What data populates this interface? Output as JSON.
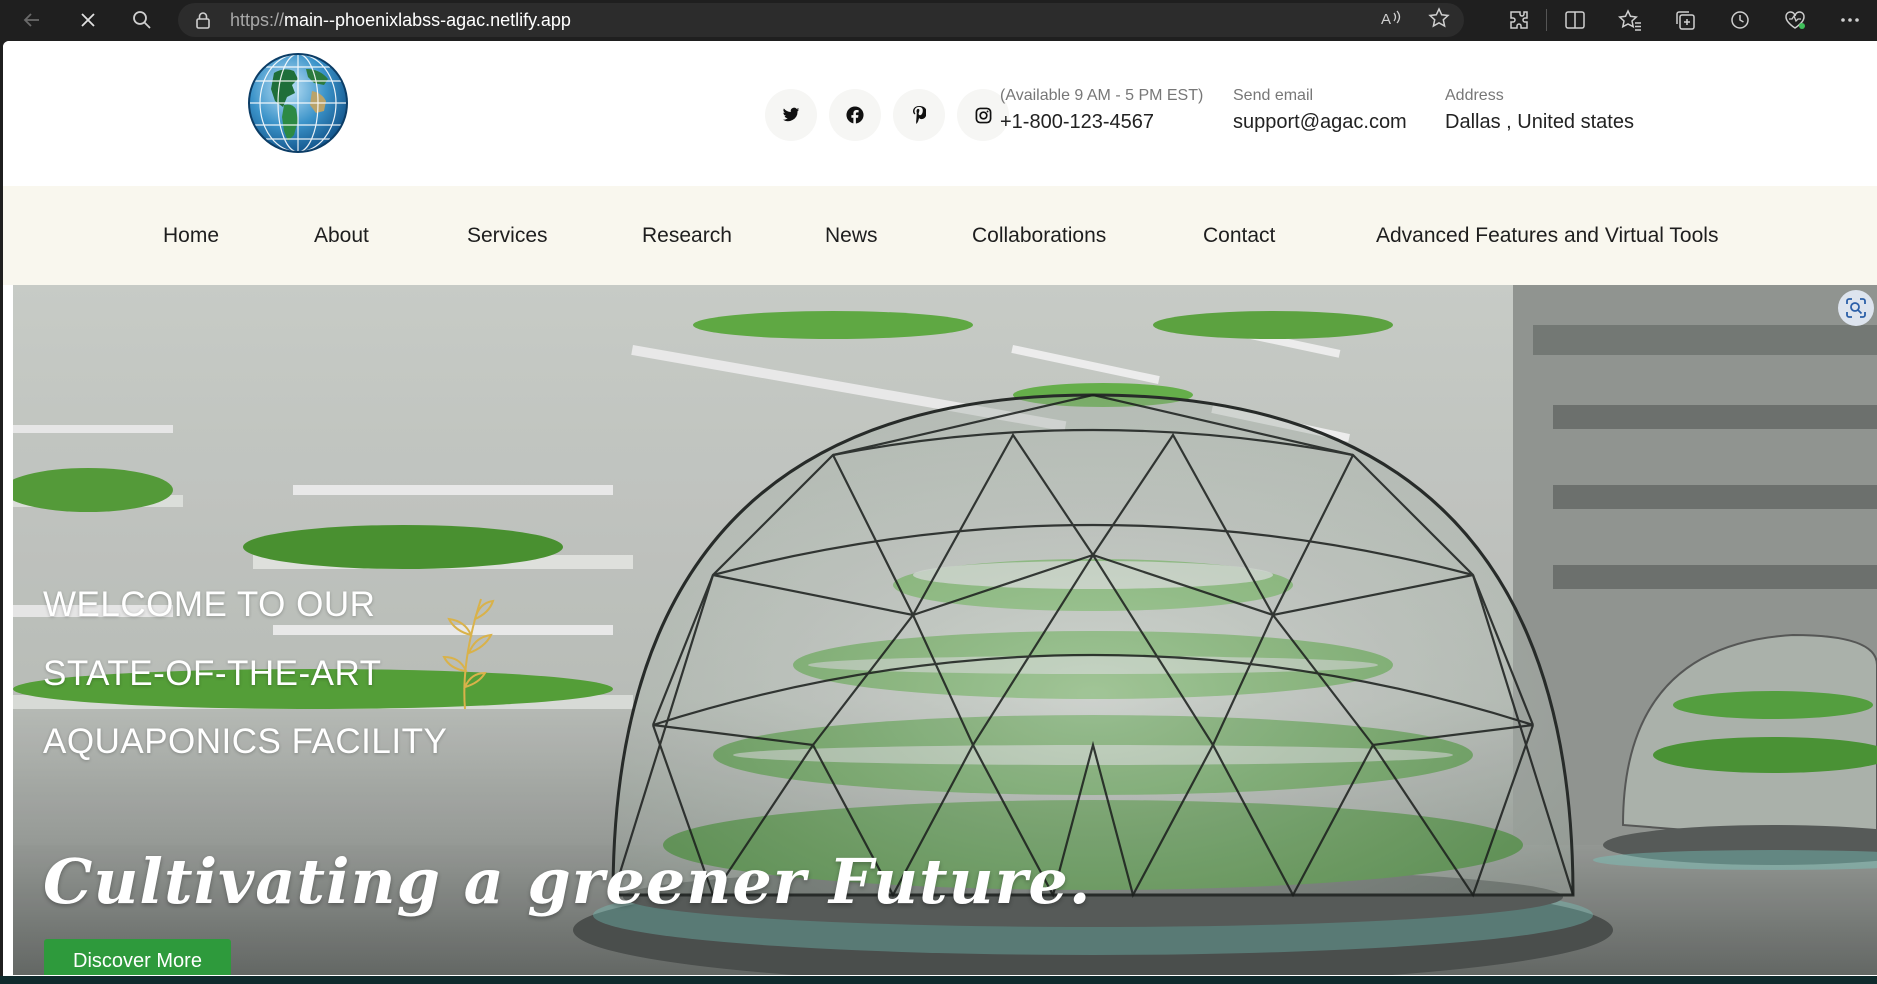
{
  "browser": {
    "url_scheme": "https://",
    "url_host": "main--phoenixlabss-agac.netlify.app",
    "icons": [
      "back-arrow-icon",
      "stop-icon",
      "search-icon",
      "lock-icon",
      "read-aloud-icon",
      "favorite-star-icon",
      "extensions-icon",
      "split-screen-icon",
      "favorites-icon",
      "collections-icon",
      "history-icon",
      "browser-essentials-icon",
      "more-icon"
    ]
  },
  "header": {
    "logo_icon": "globe-logo-icon",
    "social_icons": [
      "twitter-icon",
      "facebook-icon",
      "pinterest-icon",
      "instagram-icon"
    ],
    "phone": {
      "label": "(Available 9 AM - 5 PM EST)",
      "value": "+1-800-123-4567"
    },
    "email": {
      "label": "Send email",
      "value": "support@agac.com"
    },
    "address": {
      "label": "Address",
      "value": "Dallas , United states"
    }
  },
  "nav": {
    "items": [
      "Home",
      "About",
      "Services",
      "Research",
      "News",
      "Collaborations",
      "Contact",
      "Advanced Features and Virtual Tools"
    ]
  },
  "hero": {
    "lines": [
      "WELCOME TO OUR",
      "STATE-OF-THE-ART",
      "AQUAPONICS FACILITY"
    ],
    "tagline": "Cultivating a greener Future.",
    "cta": "Discover More",
    "leaf_icon": "leaf-sprig-icon",
    "scan_icon": "visual-search-icon"
  },
  "colors": {
    "nav_bg": "#f9f7ee",
    "cta_green": "#2e9a3c",
    "chrome_bg": "#1f1f1f"
  }
}
